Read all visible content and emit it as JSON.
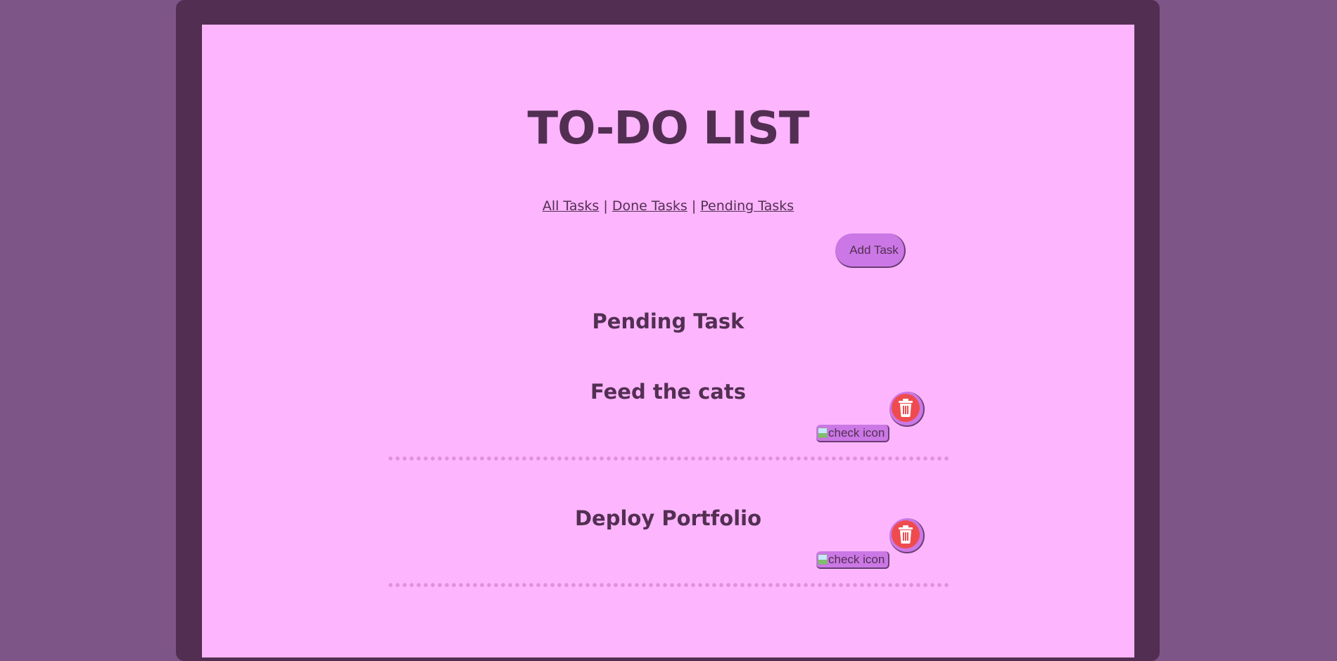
{
  "app": {
    "title": "TO-DO LIST"
  },
  "nav": {
    "all_tasks": "All Tasks",
    "done_tasks": "Done Tasks",
    "pending_tasks": "Pending Tasks",
    "separator": "|"
  },
  "toolbar": {
    "add_task_label": "Add Task"
  },
  "section": {
    "heading": "Pending Task"
  },
  "tasks": [
    {
      "name": "Feed the cats",
      "check_alt": "check icon",
      "delete_icon": "trash-icon"
    },
    {
      "name": "Deploy Portfolio",
      "check_alt": "check icon",
      "delete_icon": "trash-icon"
    }
  ],
  "colors": {
    "page_background": "#7e5587",
    "frame": "#522f52",
    "panel": "#fdb5fe",
    "button": "#cb77e5",
    "delete": "#ef4b4f",
    "divider_dots": "#e091db",
    "text": "#522f52"
  }
}
